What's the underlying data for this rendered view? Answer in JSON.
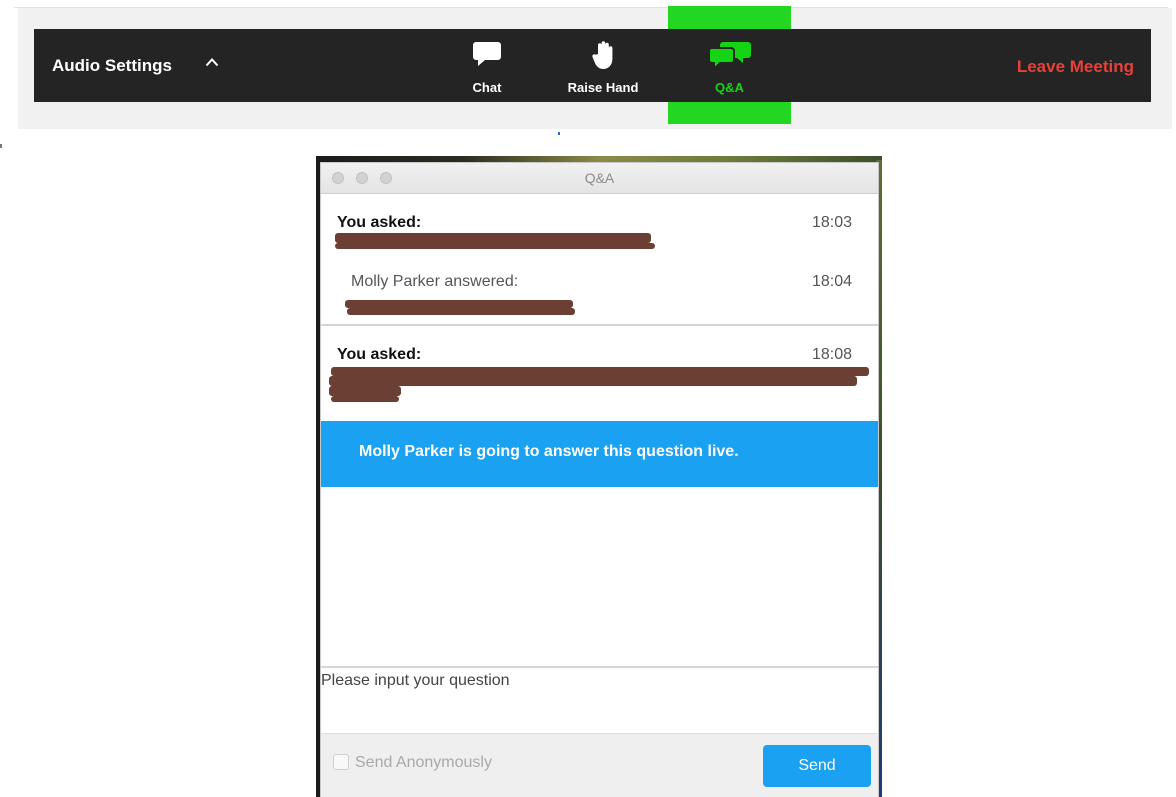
{
  "toolbar": {
    "audio_settings_label": "Audio Settings",
    "chat_label": "Chat",
    "raise_hand_label": "Raise Hand",
    "qa_label": "Q&A",
    "leave_meeting_label": "Leave Meeting",
    "icons": {
      "audio_settings_caret": "chevron-up-icon",
      "chat": "chat-bubble-icon",
      "raise_hand": "hand-icon",
      "qa": "qa-bubbles-icon"
    }
  },
  "qa_window": {
    "title": "Q&A",
    "questions": [
      {
        "asked_label": "You asked:",
        "time": "18:03",
        "answer": {
          "label": "Molly Parker answered:",
          "time": "18:04"
        }
      },
      {
        "asked_label": "You asked:",
        "time": "18:08",
        "live_notice": "Molly Parker is going to answer this question live."
      }
    ],
    "input": {
      "placeholder": "Please input your question",
      "value": ""
    },
    "send_anonymously_label": "Send Anonymously",
    "send_anonymously_checked": false,
    "send_label": "Send"
  },
  "colors": {
    "toolbar_bg": "#242424",
    "qa_active": "#14d414",
    "qa_highlight": "#22d622",
    "leave_meeting": "#e8413a",
    "accent_blue": "#1aa1f1",
    "redaction": "#6b3f33"
  }
}
